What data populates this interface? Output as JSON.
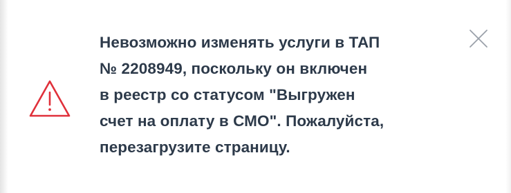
{
  "notification": {
    "type": "warning",
    "icon": "warning-triangle-icon",
    "close_icon": "close-icon",
    "accent_color": "#e0303a",
    "text_color": "#2d3a4a",
    "message_lines": [
      "Невозможно изменять услуги в ТАП",
      "№ 2208949, поскольку он включен",
      "в реестр со статусом \"Выгружен",
      "счет на оплату в СМО\". Пожалуйста,",
      "перезагрузите страницу."
    ]
  }
}
